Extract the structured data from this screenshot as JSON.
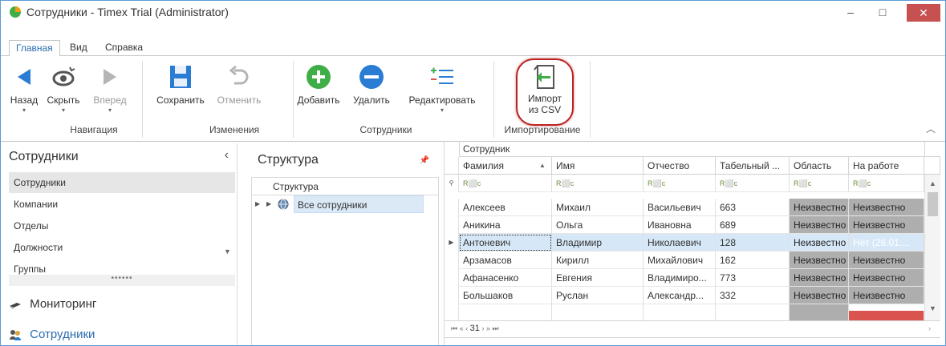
{
  "window": {
    "title": "Сотрудники - Timex Trial (Administrator)",
    "controls": {
      "minimize": "–",
      "maximize": "□",
      "close": "✕"
    }
  },
  "ribbon_tabs": [
    "Главная",
    "Вид",
    "Справка"
  ],
  "ribbon": {
    "buttons": {
      "back": "Назад",
      "hide": "Скрыть",
      "forward": "Вперед",
      "save": "Сохранить",
      "undo": "Отменить",
      "add": "Добавить",
      "delete": "Удалить",
      "edit": "Редактировать",
      "import_line1": "Импорт",
      "import_line2": "из CSV"
    },
    "groups": {
      "navigation": "Навигация",
      "changes": "Изменения",
      "employees": "Сотрудники",
      "import": "Импортирование"
    },
    "colors": {
      "blue": "#2b7cd3",
      "green": "#3fae49",
      "import_green": "#3fae49",
      "highlight": "#b22222"
    }
  },
  "nav": {
    "title": "Сотрудники",
    "items": [
      "Сотрудники",
      "Компании",
      "Отделы",
      "Должности",
      "Группы"
    ],
    "selected_index": 0,
    "groups": [
      "Мониторинг",
      "Сотрудники"
    ]
  },
  "structure": {
    "title": "Структура",
    "column": "Структура",
    "root": "Все сотрудники"
  },
  "grid": {
    "band": "Сотрудник",
    "columns": [
      "Фамилия",
      "Имя",
      "Отчество",
      "Табельный ...",
      "Область",
      "На работе"
    ],
    "filter_glyph": "R⬜c",
    "rows": [
      [
        "Алексеев",
        "Михаил",
        "Васильевич",
        "663",
        "Неизвестно",
        "Неизвестно"
      ],
      [
        "Аникина",
        "Ольга",
        "Ивановна",
        "689",
        "Неизвестно",
        "Неизвестно"
      ],
      [
        "Антоневич",
        "Владимир",
        "Николаевич",
        "128",
        "Неизвестно",
        "Нет (28.01...."
      ],
      [
        "Арзамасов",
        "Кирилл",
        "Михайлович",
        "162",
        "Неизвестно",
        "Неизвестно"
      ],
      [
        "Афанасенко",
        "Евгения",
        "Владимиро...",
        "773",
        "Неизвестно",
        "Неизвестно"
      ],
      [
        "Большаков",
        "Руслан",
        "Александр...",
        "332",
        "Неизвестно",
        "Неизвестно"
      ]
    ],
    "selected_row": 2,
    "pager": {
      "first": "⏮",
      "prev_page": "«",
      "prev": "‹",
      "current": "31",
      "next": "›",
      "next_page": "»",
      "last": "⏭"
    }
  }
}
